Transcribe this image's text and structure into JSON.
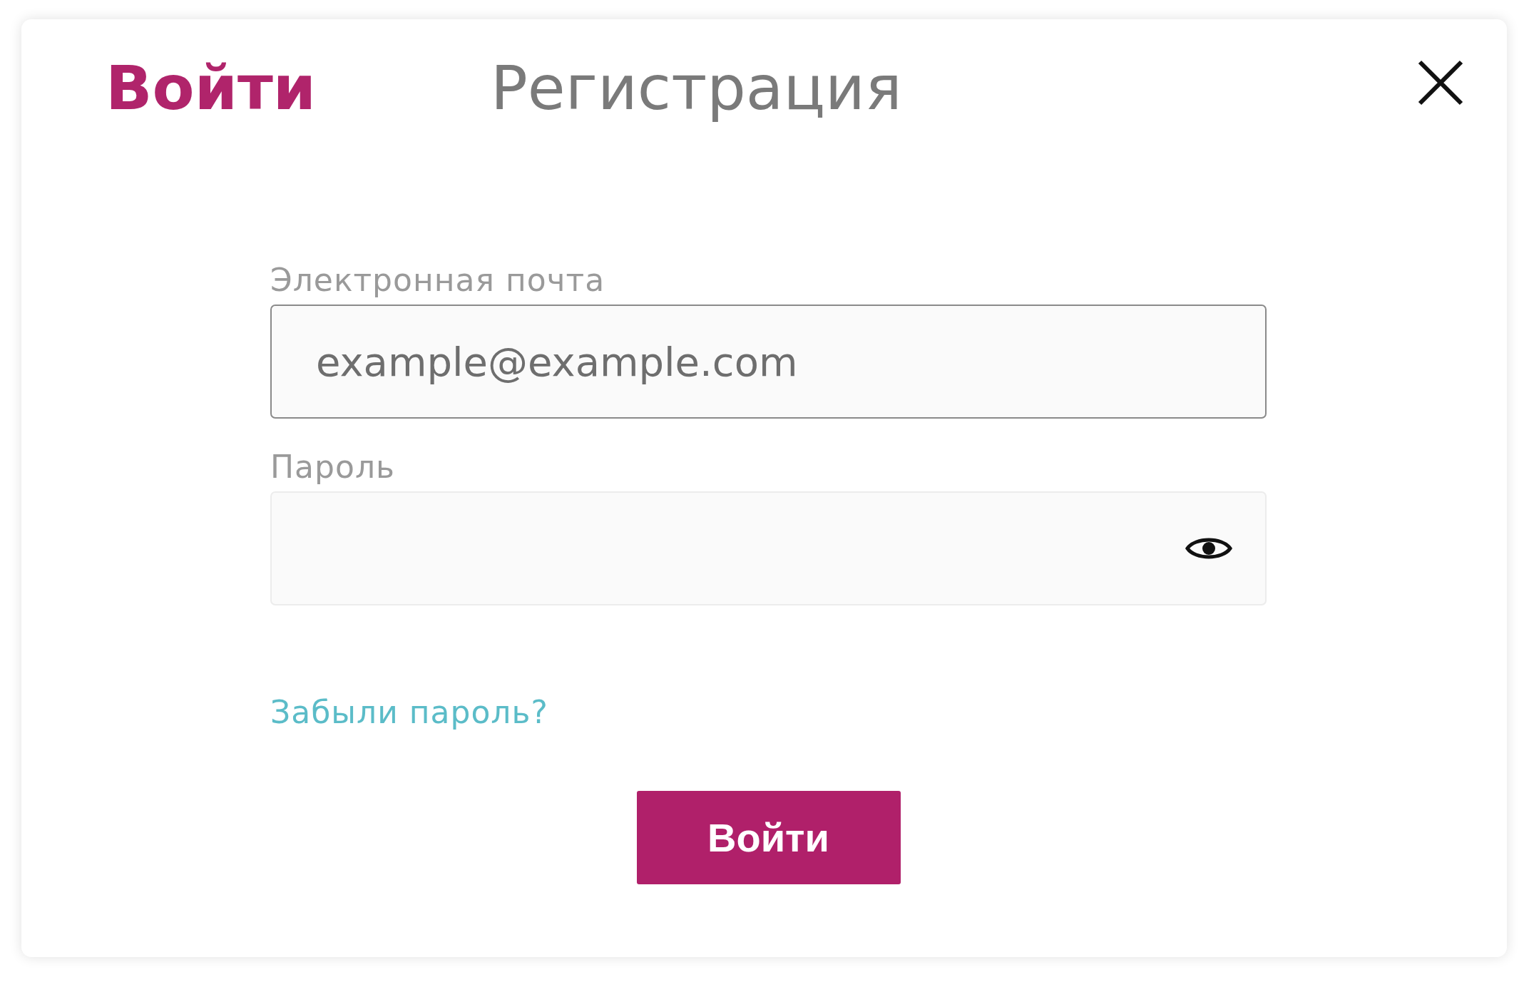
{
  "tabs": [
    {
      "label": "Войти",
      "selected": true
    },
    {
      "label": "Регистрация",
      "selected": false
    }
  ],
  "fields": [
    {
      "kind": "email",
      "label": "Электронная почта",
      "placeholder": "example@example.com",
      "focused": true
    },
    {
      "kind": "password",
      "label": "Пароль",
      "focused": false
    }
  ],
  "forgot_link": "Забыли пароль?",
  "submit_button": "Войти"
}
